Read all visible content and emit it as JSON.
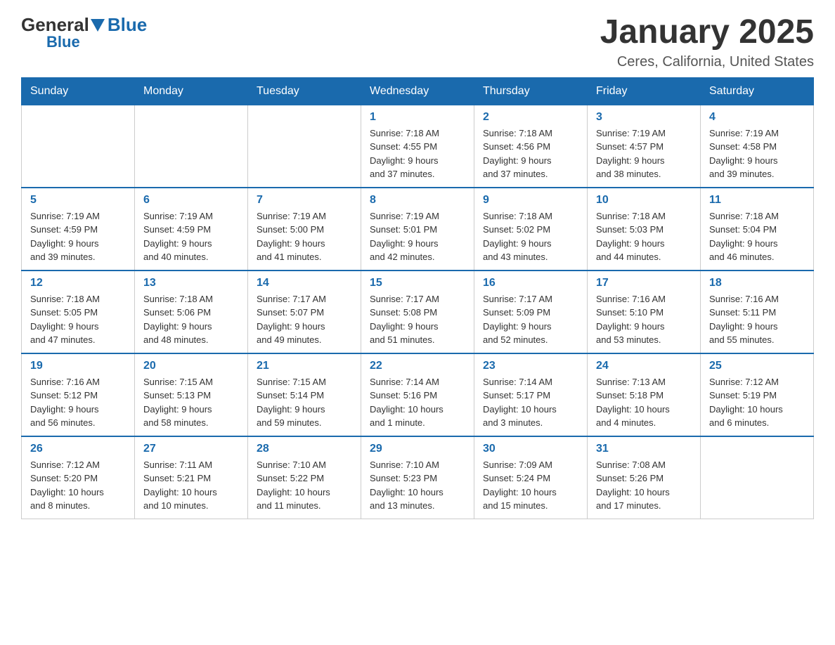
{
  "header": {
    "logo_general": "General",
    "logo_blue": "Blue",
    "main_title": "January 2025",
    "subtitle": "Ceres, California, United States"
  },
  "days_of_week": [
    "Sunday",
    "Monday",
    "Tuesday",
    "Wednesday",
    "Thursday",
    "Friday",
    "Saturday"
  ],
  "weeks": [
    [
      {
        "day": "",
        "info": ""
      },
      {
        "day": "",
        "info": ""
      },
      {
        "day": "",
        "info": ""
      },
      {
        "day": "1",
        "info": "Sunrise: 7:18 AM\nSunset: 4:55 PM\nDaylight: 9 hours\nand 37 minutes."
      },
      {
        "day": "2",
        "info": "Sunrise: 7:18 AM\nSunset: 4:56 PM\nDaylight: 9 hours\nand 37 minutes."
      },
      {
        "day": "3",
        "info": "Sunrise: 7:19 AM\nSunset: 4:57 PM\nDaylight: 9 hours\nand 38 minutes."
      },
      {
        "day": "4",
        "info": "Sunrise: 7:19 AM\nSunset: 4:58 PM\nDaylight: 9 hours\nand 39 minutes."
      }
    ],
    [
      {
        "day": "5",
        "info": "Sunrise: 7:19 AM\nSunset: 4:59 PM\nDaylight: 9 hours\nand 39 minutes."
      },
      {
        "day": "6",
        "info": "Sunrise: 7:19 AM\nSunset: 4:59 PM\nDaylight: 9 hours\nand 40 minutes."
      },
      {
        "day": "7",
        "info": "Sunrise: 7:19 AM\nSunset: 5:00 PM\nDaylight: 9 hours\nand 41 minutes."
      },
      {
        "day": "8",
        "info": "Sunrise: 7:19 AM\nSunset: 5:01 PM\nDaylight: 9 hours\nand 42 minutes."
      },
      {
        "day": "9",
        "info": "Sunrise: 7:18 AM\nSunset: 5:02 PM\nDaylight: 9 hours\nand 43 minutes."
      },
      {
        "day": "10",
        "info": "Sunrise: 7:18 AM\nSunset: 5:03 PM\nDaylight: 9 hours\nand 44 minutes."
      },
      {
        "day": "11",
        "info": "Sunrise: 7:18 AM\nSunset: 5:04 PM\nDaylight: 9 hours\nand 46 minutes."
      }
    ],
    [
      {
        "day": "12",
        "info": "Sunrise: 7:18 AM\nSunset: 5:05 PM\nDaylight: 9 hours\nand 47 minutes."
      },
      {
        "day": "13",
        "info": "Sunrise: 7:18 AM\nSunset: 5:06 PM\nDaylight: 9 hours\nand 48 minutes."
      },
      {
        "day": "14",
        "info": "Sunrise: 7:17 AM\nSunset: 5:07 PM\nDaylight: 9 hours\nand 49 minutes."
      },
      {
        "day": "15",
        "info": "Sunrise: 7:17 AM\nSunset: 5:08 PM\nDaylight: 9 hours\nand 51 minutes."
      },
      {
        "day": "16",
        "info": "Sunrise: 7:17 AM\nSunset: 5:09 PM\nDaylight: 9 hours\nand 52 minutes."
      },
      {
        "day": "17",
        "info": "Sunrise: 7:16 AM\nSunset: 5:10 PM\nDaylight: 9 hours\nand 53 minutes."
      },
      {
        "day": "18",
        "info": "Sunrise: 7:16 AM\nSunset: 5:11 PM\nDaylight: 9 hours\nand 55 minutes."
      }
    ],
    [
      {
        "day": "19",
        "info": "Sunrise: 7:16 AM\nSunset: 5:12 PM\nDaylight: 9 hours\nand 56 minutes."
      },
      {
        "day": "20",
        "info": "Sunrise: 7:15 AM\nSunset: 5:13 PM\nDaylight: 9 hours\nand 58 minutes."
      },
      {
        "day": "21",
        "info": "Sunrise: 7:15 AM\nSunset: 5:14 PM\nDaylight: 9 hours\nand 59 minutes."
      },
      {
        "day": "22",
        "info": "Sunrise: 7:14 AM\nSunset: 5:16 PM\nDaylight: 10 hours\nand 1 minute."
      },
      {
        "day": "23",
        "info": "Sunrise: 7:14 AM\nSunset: 5:17 PM\nDaylight: 10 hours\nand 3 minutes."
      },
      {
        "day": "24",
        "info": "Sunrise: 7:13 AM\nSunset: 5:18 PM\nDaylight: 10 hours\nand 4 minutes."
      },
      {
        "day": "25",
        "info": "Sunrise: 7:12 AM\nSunset: 5:19 PM\nDaylight: 10 hours\nand 6 minutes."
      }
    ],
    [
      {
        "day": "26",
        "info": "Sunrise: 7:12 AM\nSunset: 5:20 PM\nDaylight: 10 hours\nand 8 minutes."
      },
      {
        "day": "27",
        "info": "Sunrise: 7:11 AM\nSunset: 5:21 PM\nDaylight: 10 hours\nand 10 minutes."
      },
      {
        "day": "28",
        "info": "Sunrise: 7:10 AM\nSunset: 5:22 PM\nDaylight: 10 hours\nand 11 minutes."
      },
      {
        "day": "29",
        "info": "Sunrise: 7:10 AM\nSunset: 5:23 PM\nDaylight: 10 hours\nand 13 minutes."
      },
      {
        "day": "30",
        "info": "Sunrise: 7:09 AM\nSunset: 5:24 PM\nDaylight: 10 hours\nand 15 minutes."
      },
      {
        "day": "31",
        "info": "Sunrise: 7:08 AM\nSunset: 5:26 PM\nDaylight: 10 hours\nand 17 minutes."
      },
      {
        "day": "",
        "info": ""
      }
    ]
  ]
}
